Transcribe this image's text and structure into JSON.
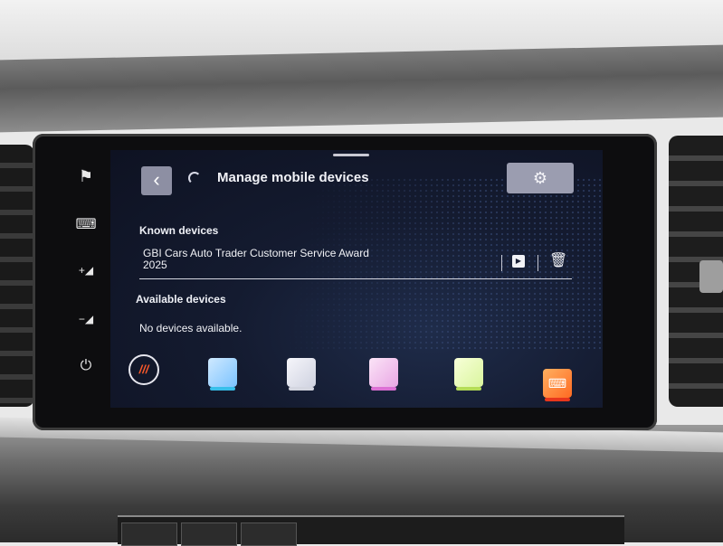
{
  "screen": {
    "title": "Manage mobile devices",
    "back_icon": "‹",
    "settings_icon": "⚙"
  },
  "known_devices": {
    "label": "Known devices",
    "items": [
      {
        "name": "GBI Cars Auto Trader Customer Service Award 2025"
      }
    ]
  },
  "available_devices": {
    "label": "Available devices",
    "empty_text": "No devices available."
  },
  "side_keys": {
    "flag": "⚑",
    "keyboard": "⌨",
    "volume_up": "+◢",
    "volume_down": "−◢",
    "power": "⏻"
  },
  "dock": {
    "home_label": "///",
    "apps_icon": "⌨"
  },
  "colors": {
    "accent": "#ff5a2a",
    "screen_bg": "#141b30",
    "button_bg": "#9b9db0"
  }
}
